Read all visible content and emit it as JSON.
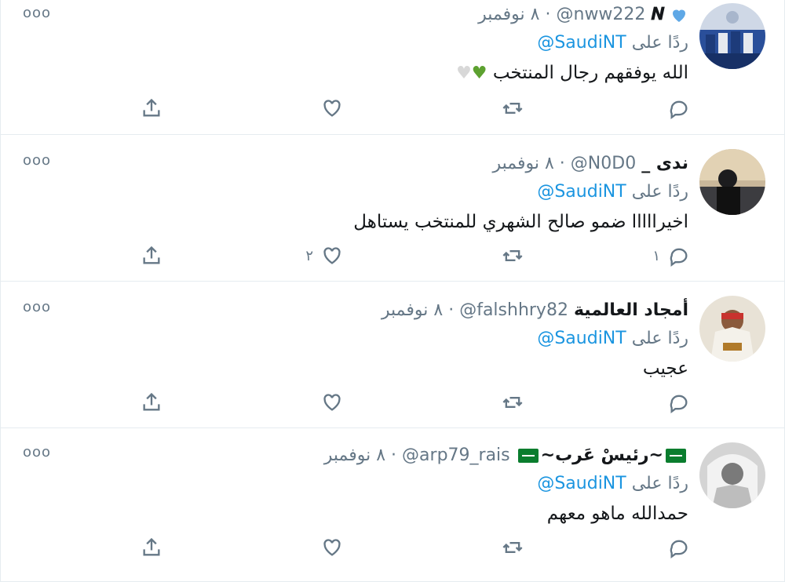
{
  "colors": {
    "link": "#1b95e0",
    "muted": "#657786",
    "text": "#14171a",
    "border": "#e6ecf0"
  },
  "more_label": "ooo",
  "tweets": [
    {
      "name": "𝑵",
      "handle": "@nww222",
      "separator": "·",
      "date": "٨ نوفمبر",
      "reply_prefix": "ردًا على",
      "reply_to": "@SaudiNT",
      "text": "الله يوفقهم رجال المنتخب",
      "emojis": [
        "green-heart",
        "white-heart"
      ],
      "badge_icon": "blue-heart-icon",
      "reply_count": "",
      "like_count": ""
    },
    {
      "name": "ندى _",
      "handle": "@N0D0",
      "separator": "·",
      "date": "٨ نوفمبر",
      "reply_prefix": "ردًا على",
      "reply_to": "@SaudiNT",
      "text": "اخيرااااا ضمو صالح الشهري للمنتخب يستاهل",
      "reply_count": "١",
      "like_count": "٢"
    },
    {
      "name": "أمجاد العالمية",
      "handle": "@falshhry82",
      "separator": "·",
      "date": "٨ نوفمبر",
      "reply_prefix": "ردًا على",
      "reply_to": "@SaudiNT",
      "text": "عجيب",
      "reply_count": "",
      "like_count": ""
    },
    {
      "name": "~رئيسْ عَرب~",
      "handle": "@arp79_rais",
      "separator": "·",
      "date": "٨ نوفمبر",
      "reply_prefix": "ردًا على",
      "reply_to": "@SaudiNT",
      "text": "حمدالله ماهو معهم",
      "reply_count": "",
      "like_count": ""
    }
  ]
}
